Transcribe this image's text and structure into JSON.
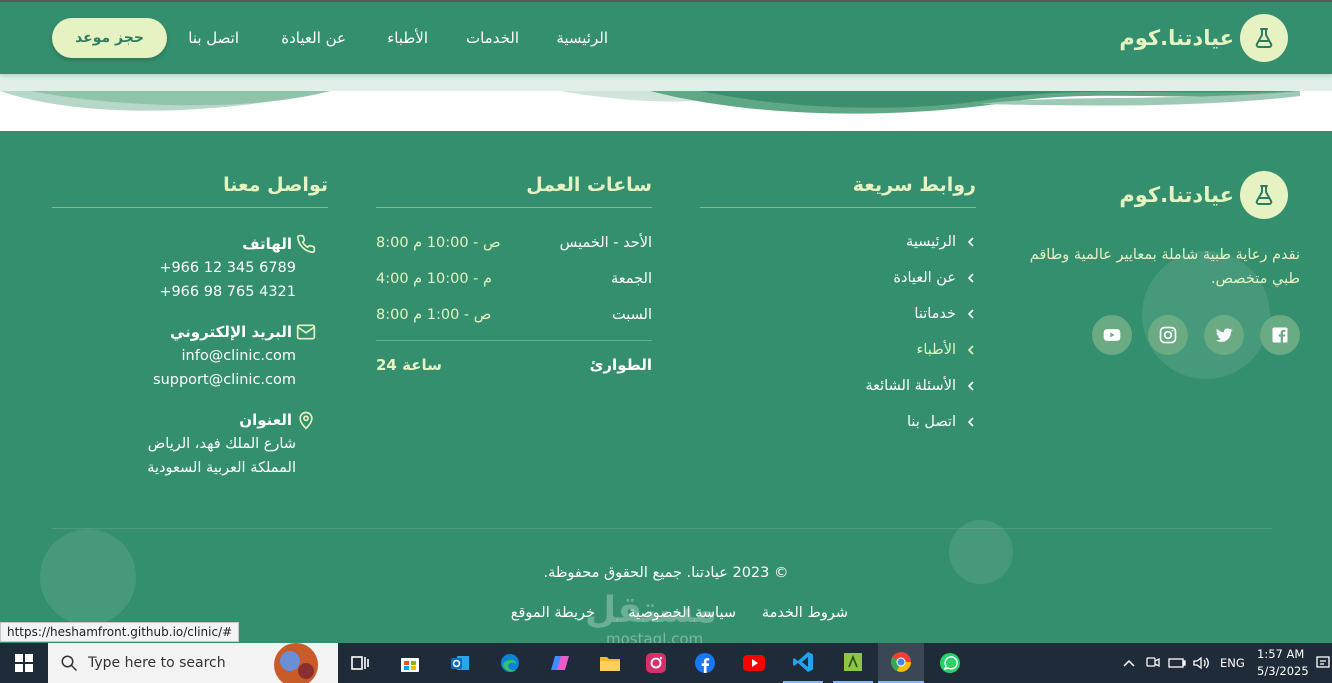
{
  "brand": {
    "name": "عيادتنا.كوم",
    "logo_icon": "flask-icon"
  },
  "nav": {
    "items": [
      "الرئيسية",
      "الخدمات",
      "الأطباء",
      "عن العيادة",
      "اتصل بنا"
    ],
    "cta_label": "حجز موعد"
  },
  "footer": {
    "about_text": "نقدم رعاية طبية شاملة بمعايير عالمية وطاقم طبي متخصص.",
    "social_icons": [
      "facebook-icon",
      "twitter-icon",
      "instagram-icon",
      "youtube-icon"
    ],
    "quick_links": {
      "title": "روابط سريعة",
      "items": [
        "الرئيسية",
        "عن العيادة",
        "خدماتنا",
        "الأطباء",
        "الأسئلة الشائعة",
        "اتصل بنا"
      ]
    },
    "hours": {
      "title": "ساعات العمل",
      "rows": [
        {
          "day": "الأحد - الخميس",
          "time": "8:00 ص - 10:00 م"
        },
        {
          "day": "الجمعة",
          "time": "4:00 م - 10:00 م"
        },
        {
          "day": "السبت",
          "time": "8:00 ص - 1:00 م"
        }
      ],
      "emergency_label": "الطوارئ",
      "emergency_value": "24 ساعة"
    },
    "contact": {
      "title": "تواصل معنا",
      "phone_label": "الهاتف",
      "phones": [
        "+966 12 345 6789",
        "+966 98 765 4321"
      ],
      "email_label": "البريد الإلكتروني",
      "emails": [
        "info@clinic.com",
        "support@clinic.com"
      ],
      "address_label": "العنوان",
      "address_lines": [
        "شارع الملك فهد، الرياض",
        "المملكة العربية السعودية"
      ]
    },
    "copyright": "© 2023 عيادتنا. جميع الحقوق محفوظة.",
    "bottom_links": [
      "شروط الخدمة",
      "سياسة الخصوصية",
      "خريطة الموقع"
    ]
  },
  "watermark": {
    "text": "مستقل",
    "sub": "mostaql.com"
  },
  "status_url": "https://heshamfront.github.io/clinic/#",
  "taskbar": {
    "search_placeholder": "Type here to search",
    "language": "ENG",
    "time": "1:57 AM",
    "date": "5/3/2025"
  },
  "colors": {
    "primary": "#348f6e",
    "accent": "#e6f2c2",
    "social": "#6aab84"
  }
}
